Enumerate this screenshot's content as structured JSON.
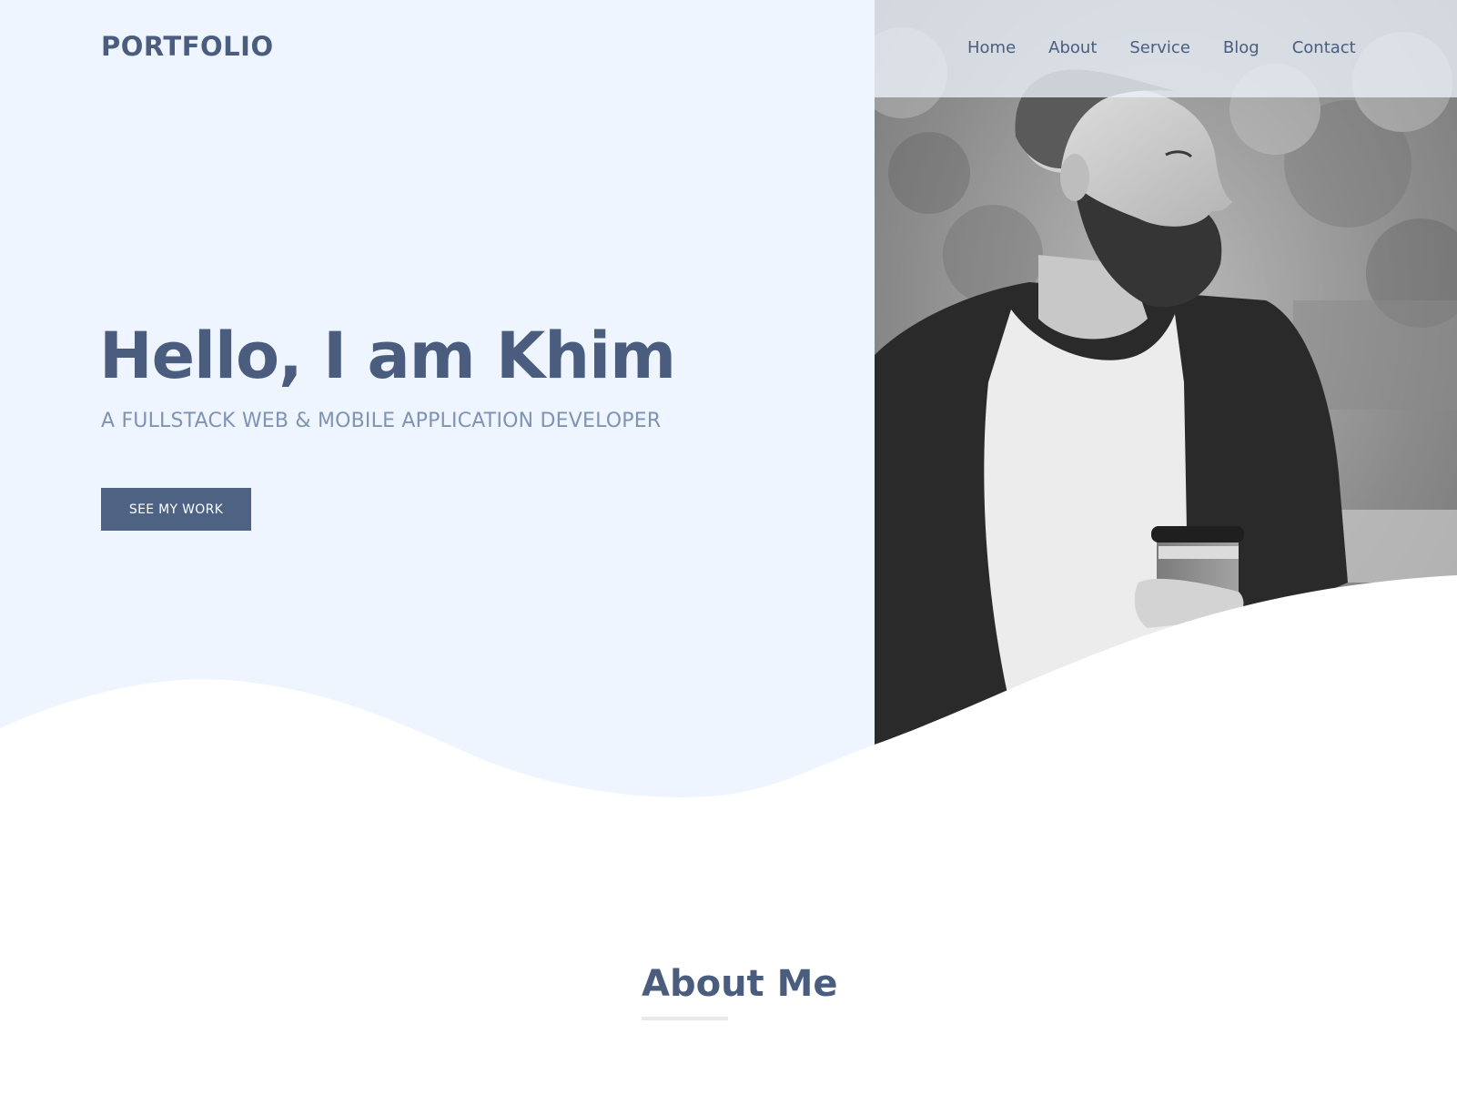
{
  "brand": {
    "logo_text": "PORTFOLIO"
  },
  "nav": {
    "items": [
      {
        "label": "Home"
      },
      {
        "label": "About"
      },
      {
        "label": "Service"
      },
      {
        "label": "Blog"
      },
      {
        "label": "Contact"
      }
    ]
  },
  "hero": {
    "title": "Hello, I am Khim",
    "subtitle": "A FULLSTACK WEB & MOBILE APPLICATION DEVELOPER",
    "cta_label": "SEE MY WORK",
    "photo_icon": "portrait-photo"
  },
  "about": {
    "heading": "About Me"
  },
  "colors": {
    "primary": "#4a5d7e",
    "button": "#4e6384",
    "subtitle": "#7f93b3",
    "hero_bg": "#eef5ff",
    "page_bg": "#ffffff"
  }
}
